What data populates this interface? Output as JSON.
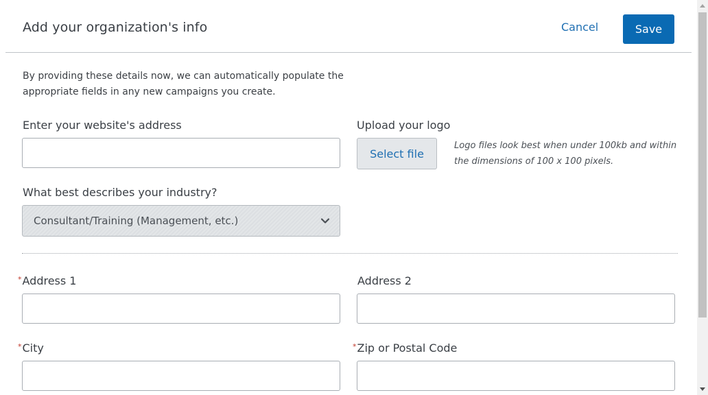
{
  "header": {
    "title": "Add your organization's info",
    "cancel_label": "Cancel",
    "save_label": "Save"
  },
  "intro": {
    "text": "By providing these details now, we can automatically populate the appropriate fields in any new campaigns you create."
  },
  "website": {
    "label": "Enter your website's address",
    "value": ""
  },
  "logo": {
    "label": "Upload your logo",
    "button_label": "Select file",
    "hint": "Logo files look best when under 100kb and within the dimensions of 100 x 100 pixels."
  },
  "industry": {
    "label": "What best describes your industry?",
    "selected": "Consultant/Training (Management, etc.)"
  },
  "address1": {
    "label": "Address 1",
    "required": true,
    "value": ""
  },
  "address2": {
    "label": "Address 2",
    "required": false,
    "value": ""
  },
  "city": {
    "label": "City",
    "required": true,
    "value": ""
  },
  "zip": {
    "label": "Zip or Postal Code",
    "required": true,
    "value": ""
  },
  "required_marker": "*",
  "colors": {
    "accent": "#0a6ab3",
    "link": "#1f6fb2",
    "required": "#c0392b"
  },
  "icons": {
    "select_chevron": "chevron-down-icon",
    "scroll_up": "scroll-up-arrow-icon",
    "scroll_down": "scroll-down-arrow-icon"
  }
}
